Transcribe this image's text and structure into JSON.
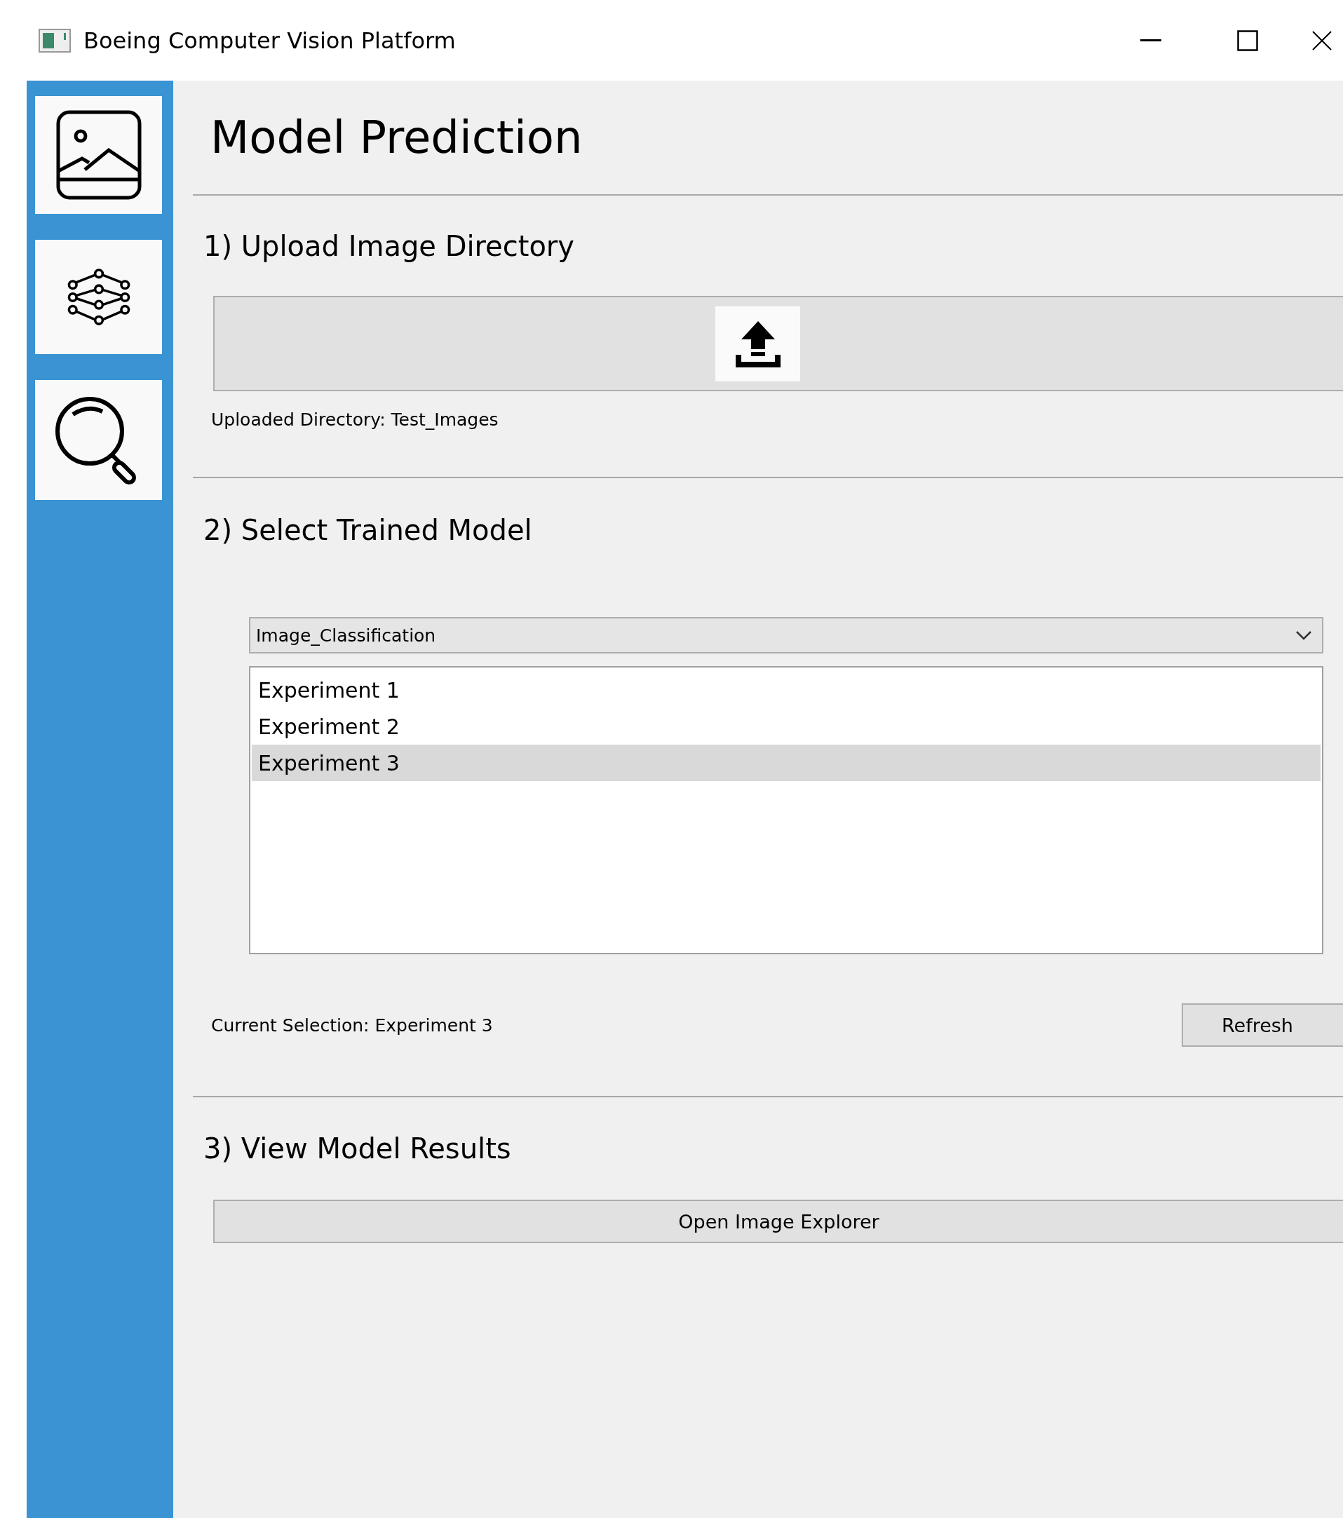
{
  "window": {
    "title": "Boeing Computer Vision Platform"
  },
  "heading": "Model Prediction",
  "sections": [
    {
      "kind": "upload",
      "title": "1) Upload Image Directory",
      "status": "Uploaded Directory: Test_Images"
    },
    {
      "kind": "model",
      "title": "2) Select Trained Model",
      "dropdown": {
        "value": "Image_Classification"
      },
      "list": [
        {
          "label": "Experiment 1",
          "selected": false
        },
        {
          "label": "Experiment 2",
          "selected": false
        },
        {
          "label": "Experiment 3",
          "selected": true
        }
      ],
      "status": "Current Selection: Experiment 3",
      "button": "Refresh"
    },
    {
      "kind": "results",
      "title": "3) View Model Results",
      "button": "Open Image Explorer"
    }
  ]
}
